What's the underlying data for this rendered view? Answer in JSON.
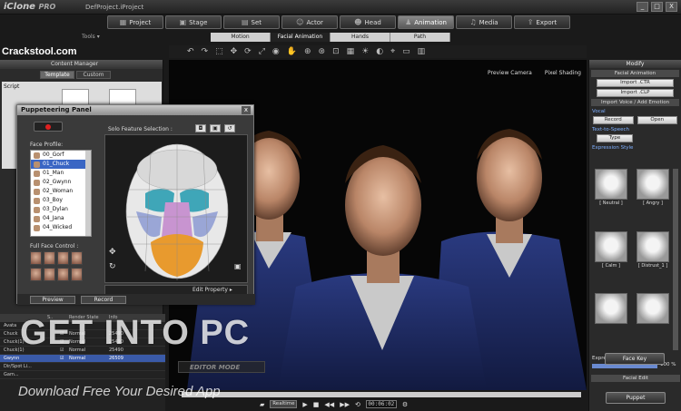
{
  "app": {
    "logo": "iClone",
    "edition": "PRO",
    "project": "DefProject.iProject",
    "window_controls": [
      "_",
      "□",
      "X"
    ]
  },
  "main_tabs": [
    {
      "label": "Project",
      "icon": "project-icon",
      "active": false
    },
    {
      "label": "Stage",
      "icon": "stage-icon",
      "active": false
    },
    {
      "label": "Set",
      "icon": "set-icon",
      "active": false
    },
    {
      "label": "Actor",
      "icon": "actor-icon",
      "active": false
    },
    {
      "label": "Head",
      "icon": "head-icon",
      "active": false
    },
    {
      "label": "Animation",
      "icon": "animation-icon",
      "active": true
    },
    {
      "label": "Media",
      "icon": "media-icon",
      "active": false
    },
    {
      "label": "Export",
      "icon": "export-icon",
      "active": false
    }
  ],
  "tools_label": "Tools ▾",
  "sub_tabs": [
    {
      "label": "Motion",
      "active": false
    },
    {
      "label": "Facial Animation",
      "active": true
    },
    {
      "label": "Hands",
      "active": false
    },
    {
      "label": "Path",
      "active": false
    }
  ],
  "left": {
    "site": "Crackstool.com",
    "content_manager": {
      "title": "Content Manager",
      "tabs": [
        "Template",
        "Custom"
      ],
      "tree_item": "Script"
    }
  },
  "puppeteering": {
    "title": "Puppeteering Panel",
    "close": "x",
    "solo_label": "Solo Feature Selection :",
    "face_profile_label": "Face Profile:",
    "profiles": [
      "00_Gorf",
      "01_Chuck",
      "01_Man",
      "02_Gwynn",
      "02_Woman",
      "03_Boy",
      "03_Dylan",
      "04_Jana",
      "04_Wicked"
    ],
    "selected_profile": 1,
    "full_face_label": "Full Face Control :",
    "edit_property": "Edit Property",
    "preview": "Preview",
    "record": "Record"
  },
  "scene": {
    "headers": [
      "",
      "S..",
      "",
      "Render State",
      "Info"
    ],
    "rows": [
      {
        "name": "Avata",
        "state": "",
        "info": "",
        "selected": false
      },
      {
        "name": "Chuck",
        "state": "Normal",
        "info": "25490",
        "selected": false
      },
      {
        "name": "Chuck(1)",
        "state": "Normal",
        "info": "25490",
        "selected": false
      },
      {
        "name": "Chuck(1)",
        "state": "Normal",
        "info": "25490",
        "selected": false
      },
      {
        "name": "Gwynn",
        "state": "Normal",
        "info": "26509",
        "selected": true
      },
      {
        "name": "Dir/Spot Li...",
        "state": "",
        "info": "",
        "selected": false
      },
      {
        "name": "Gam...",
        "state": "",
        "info": "",
        "selected": false
      }
    ]
  },
  "viewport": {
    "camera": "Preview Camera",
    "shading": "Pixel Shading",
    "mode": "EDITOR MODE"
  },
  "modify": {
    "title": "Modify",
    "facial_animation": "Facial Animation",
    "import_ctr": "Import .CTR",
    "import_clp": "Import .CLP",
    "import_voice": "Import Voice / Add Emotion",
    "vocal": "Vocal",
    "record": "Record",
    "open": "Open",
    "tts": "Text-to-Speech",
    "type": "Type",
    "expression_style": "Expression Style",
    "expressions": [
      "[ Neutral ]",
      "[ Angry ]",
      "[ Calm ]",
      "[ Distrust_1 ]",
      "",
      ""
    ],
    "strength_label": "Expression Strength",
    "strength_value": "100",
    "strength_unit": "%",
    "strength_fraction": 1.0,
    "facial_edit": "Facial Edit",
    "puppet": "Puppet",
    "face_key": "Face Key"
  },
  "timeline": {
    "mode": "Realtime",
    "time": "00:06:02"
  },
  "watermark": {
    "logo": "GET INTO PC",
    "sub": "Download Free Your Desired App"
  }
}
